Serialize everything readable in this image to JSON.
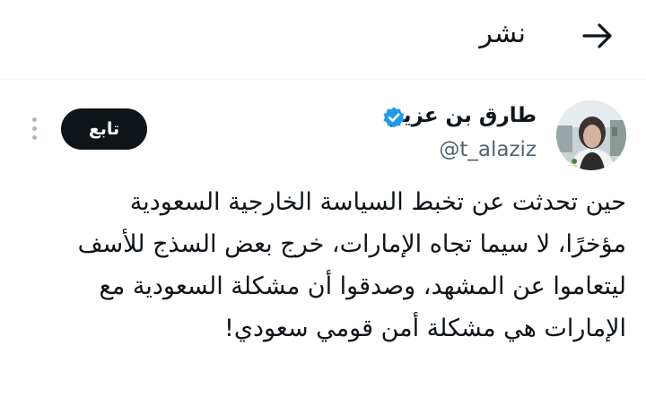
{
  "header": {
    "title": "نشر",
    "back_icon": "arrow-right-icon"
  },
  "tweet": {
    "author": {
      "display_name": "طارق بن عزيز",
      "handle": "@t_alaziz",
      "verified": true,
      "verified_color": "#1d9bf0"
    },
    "follow_label": "تابع",
    "more_icon": "more-vertical-icon",
    "text_lines": [
      "حين تحدثت عن تخبط السياسة الخارجية السعودية",
      "مؤخرًا، لا سيما تجاه الإمارات، خرج بعض السذج للأسف",
      "ليتعاموا عن المشهد، وصدقوا أن مشكلة السعودية مع",
      "الإمارات هي مشكلة أمن قومي سعودي!"
    ]
  }
}
